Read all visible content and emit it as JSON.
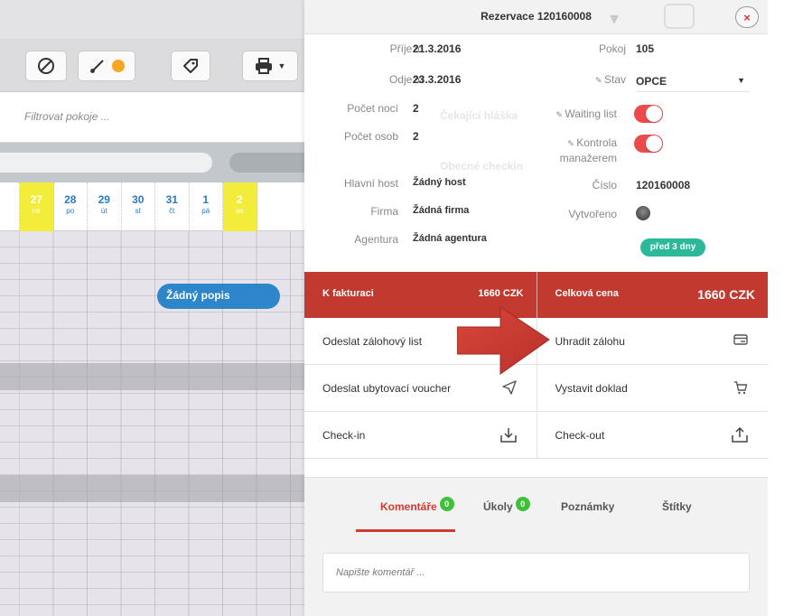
{
  "calendar": {
    "filter_placeholder": "Filtrovat pokoje ...",
    "days": [
      {
        "num": "27",
        "dow": "ne",
        "weekend": true
      },
      {
        "num": "28",
        "dow": "po",
        "weekend": false
      },
      {
        "num": "29",
        "dow": "út",
        "weekend": false
      },
      {
        "num": "30",
        "dow": "st",
        "weekend": false
      },
      {
        "num": "31",
        "dow": "čt",
        "weekend": false
      },
      {
        "num": "1",
        "dow": "pá",
        "weekend": false
      },
      {
        "num": "2",
        "dow": "so",
        "weekend": true
      }
    ],
    "booking_label": "Žádný popis",
    "colors": {
      "weekend": "#f4ec3a",
      "booking": "#2d86c9",
      "accent_orange": "#f5a623"
    }
  },
  "panel": {
    "title": "Rezervace 120160008",
    "close_label": "×",
    "fields": {
      "arrival_label": "Příjezd",
      "arrival": "21.3.2016",
      "room_label": "Pokoj",
      "room": "105",
      "departure_label": "Odjezd",
      "departure": "23.3.2016",
      "status_label": "Stav",
      "status": "OPCE",
      "nights_label": "Počet nocí",
      "nights": "2",
      "waiting_label": "Waiting list",
      "guests_label": "Počet osob",
      "guests": "2",
      "manager_label_1": "Kontrola",
      "manager_label_2": "manažerem",
      "main_guest_label": "Hlavní host",
      "main_guest": "Žádný host",
      "number_label": "Číslo",
      "number": "120160008",
      "company_label": "Firma",
      "company": "Žádná firma",
      "created_label": "Vytvořeno",
      "agency_label": "Agentura",
      "agency": "Žádná agentura",
      "created_ago": "před 3 dny"
    },
    "price": {
      "to_invoice_label": "K fakturaci",
      "to_invoice": "1660 CZK",
      "total_label": "Celková cena",
      "total": "1660 CZK"
    },
    "actions": {
      "send_deposit": "Odeslat zálohový list",
      "pay_deposit": "Uhradit zálohu",
      "send_voucher": "Odeslat ubytovací voucher",
      "issue_document": "Vystavit doklad",
      "checkin": "Check-in",
      "checkout": "Check-out"
    },
    "tabs": {
      "comments": "Komentáře",
      "comments_count": "0",
      "tasks": "Úkoly",
      "tasks_count": "0",
      "notes": "Poznámky",
      "tags": "Štítky"
    },
    "comment_placeholder": "Napište komentář ...",
    "colors": {
      "red": "#c23a2f",
      "toggle": "#ec4b4b",
      "green_badge": "#2bb99a",
      "count_badge": "#3fbf3a"
    }
  }
}
